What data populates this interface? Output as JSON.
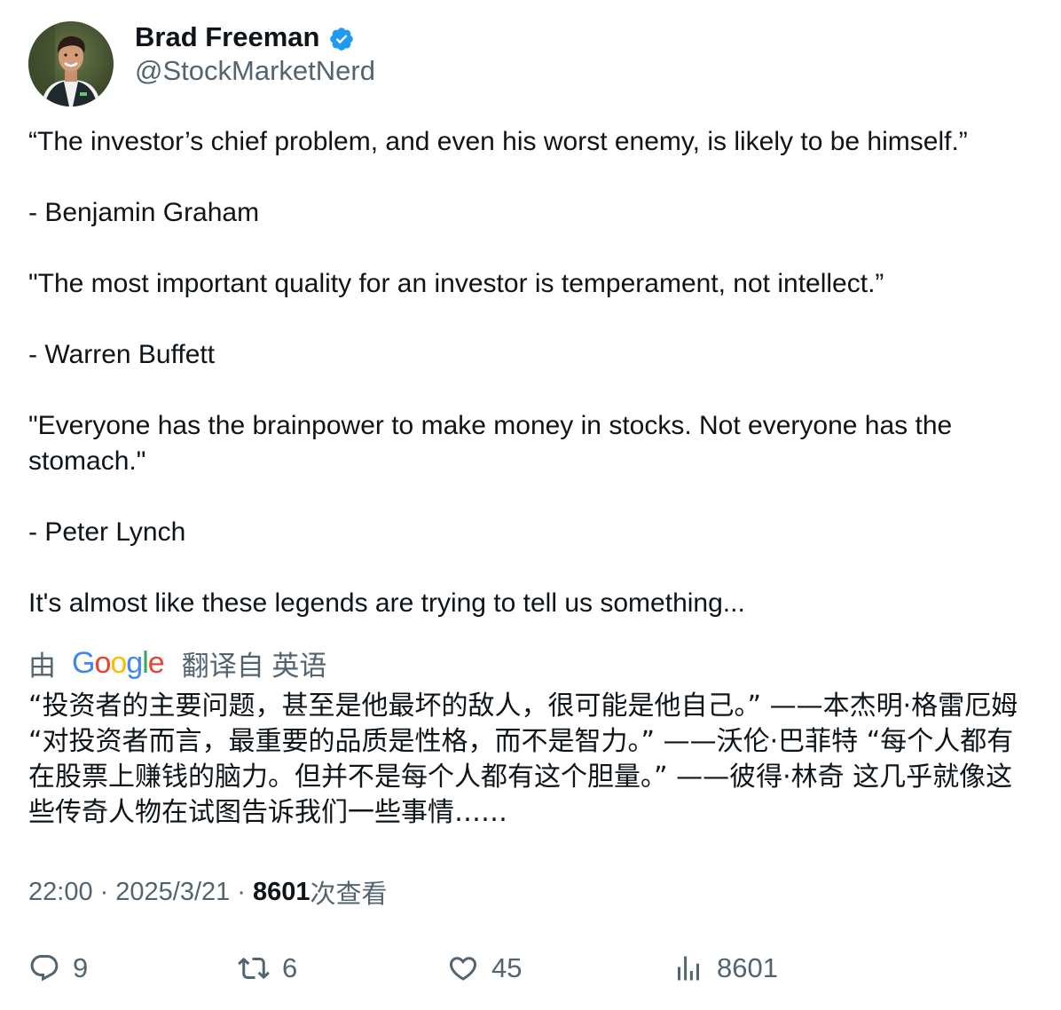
{
  "author": {
    "display_name": "Brad Freeman",
    "handle": "@StockMarketNerd",
    "verified": true,
    "verified_color": "#1d9bf0"
  },
  "tweet": {
    "paragraphs": [
      "“The investor’s chief problem, and even his worst enemy, is likely to be himself.”",
      "- Benjamin Graham",
      "\"The most important quality for an investor is temperament, not intellect.”",
      "- Warren Buffett",
      "\"Everyone has the brainpower to make money in stocks. Not everyone has the stomach.\"",
      "- Peter Lynch",
      "It's almost like these legends are trying to tell us something..."
    ]
  },
  "translation": {
    "prefix": "由",
    "brand": "Google",
    "suffix": "翻译自 英语",
    "text": "“投资者的主要问题，甚至是他最坏的敌人，很可能是他自己。” ——本杰明·格雷厄姆 “对投资者而言，最重要的品质是性格，而不是智力。” ——沃伦·巴菲特 “每个人都有在股票上赚钱的脑力。但并不是每个人都有这个胆量。” ——彼得·林奇 这几乎就像这些传奇人物在试图告诉我们一些事情……"
  },
  "meta": {
    "time": "22:00",
    "separator": "·",
    "date": "2025/3/21",
    "views_count": "8601",
    "views_label": "次查看"
  },
  "actions": {
    "replies": {
      "icon": "reply-icon",
      "count": "9"
    },
    "retweets": {
      "icon": "retweet-icon",
      "count": "6"
    },
    "likes": {
      "icon": "heart-icon",
      "count": "45"
    },
    "views": {
      "icon": "views-chart-icon",
      "count": "8601"
    }
  },
  "colors": {
    "text_primary": "#0f1419",
    "text_secondary": "#536471",
    "google_blue": "#4285f4",
    "google_red": "#ea4335",
    "google_yellow": "#fbbc05",
    "google_green": "#34a853"
  }
}
